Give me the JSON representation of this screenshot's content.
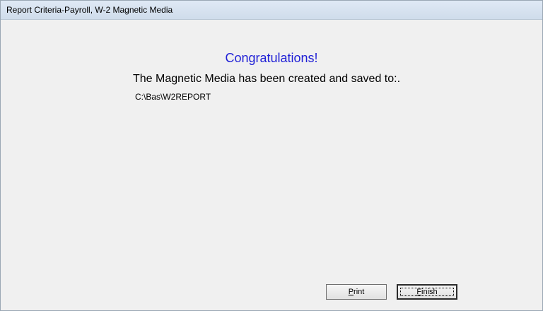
{
  "window": {
    "title": "Report Criteria-Payroll, W-2 Magnetic Media"
  },
  "main": {
    "heading": "Congratulations!",
    "message": "The Magnetic Media has been created and saved to:.",
    "path": "C:\\Bas\\W2REPORT"
  },
  "buttons": {
    "print": {
      "mnemonic": "P",
      "rest": "rint"
    },
    "finish": {
      "mnemonic": "F",
      "rest": "inish"
    }
  },
  "colors": {
    "heading": "#1f1fd6",
    "background": "#f0f0f0"
  }
}
